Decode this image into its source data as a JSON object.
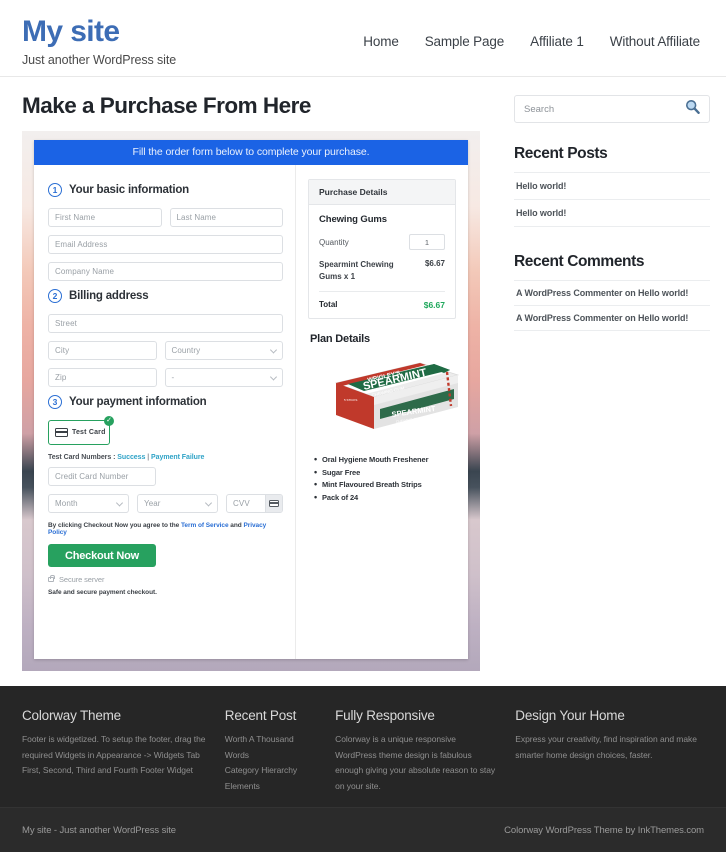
{
  "header": {
    "site_title": "My site",
    "tagline": "Just another WordPress site",
    "nav": [
      {
        "label": "Home"
      },
      {
        "label": "Sample Page"
      },
      {
        "label": "Affiliate 1"
      },
      {
        "label": "Without Affiliate"
      }
    ]
  },
  "main": {
    "page_heading": "Make a Purchase From Here",
    "banner": "Fill the order form below to complete your purchase.",
    "steps": {
      "one": {
        "num": "1",
        "title": "Your basic information"
      },
      "two": {
        "num": "2",
        "title": "Billing address"
      },
      "three": {
        "num": "3",
        "title": "Your payment information"
      }
    },
    "fields": {
      "first_name": "First Name",
      "last_name": "Last Name",
      "email": "Email Address",
      "company": "Company Name",
      "street": "Street",
      "city": "City",
      "country": "Country",
      "zip": "Zip",
      "state": "-",
      "credit_card": "Credit Card Number",
      "month": "Month",
      "year": "Year",
      "cvv": "CVV"
    },
    "payment": {
      "tile_label": "Test Card",
      "tile_check": "✓",
      "testcards_prefix": "Test Card Numbers : ",
      "testcards_success": "Success",
      "testcards_sep": " | ",
      "testcards_failure": "Payment Failure",
      "terms_prefix": "By clicking Checkout Now you agree to the ",
      "terms_tos": "Term of Service",
      "terms_and": " and ",
      "terms_privacy": "Privacy Policy",
      "checkout_label": "Checkout Now",
      "secure_server": "Secure server",
      "safe_note": "Safe and secure payment checkout."
    },
    "summary": {
      "head": "Purchase Details",
      "product": "Chewing Gums",
      "qty_label": "Quantity",
      "qty_value": "1",
      "line_name": "Spearmint Chewing Gums x 1",
      "line_price": "$6.67",
      "total_label": "Total",
      "total_price": "$6.67",
      "plan_title": "Plan Details",
      "features": [
        "Oral Hygiene Mouth Freshener",
        "Sugar Free",
        "Mint Flavoured Breath Strips",
        "Pack of 24"
      ]
    }
  },
  "sidebar": {
    "search_placeholder": "Search",
    "recent_posts": {
      "title": "Recent Posts",
      "items": [
        "Hello world!",
        "Hello world!"
      ]
    },
    "recent_comments": {
      "title": "Recent Comments",
      "items": [
        "A WordPress Commenter on Hello world!",
        "A WordPress Commenter on Hello world!"
      ]
    }
  },
  "footer": {
    "columns": [
      {
        "heading": "Colorway Theme",
        "text": "Footer is widgetized. To setup the footer, drag the required Widgets in Appearance -> Widgets Tab First, Second, Third and Fourth Footer Widget"
      },
      {
        "heading": "Recent Post",
        "items": [
          "Worth A Thousand Words",
          "Category Hierarchy",
          "Elements"
        ]
      },
      {
        "heading": "Fully Responsive",
        "text": "Colorway is a unique responsive WordPress theme design is fabulous enough giving your absolute reason to stay on your site."
      },
      {
        "heading": "Design Your Home",
        "text": "Express your creativity, find inspiration and make smarter home design choices, faster."
      }
    ],
    "bottom_left": "My site - Just another WordPress site",
    "bottom_right": "Colorway WordPress Theme by InkThemes.com"
  },
  "colors": {
    "brand": "#3d6db5",
    "banner_blue": "#1b63e5",
    "success_green": "#27a15f",
    "link_blue": "#2b6fd4",
    "footer_bg": "#262626"
  }
}
